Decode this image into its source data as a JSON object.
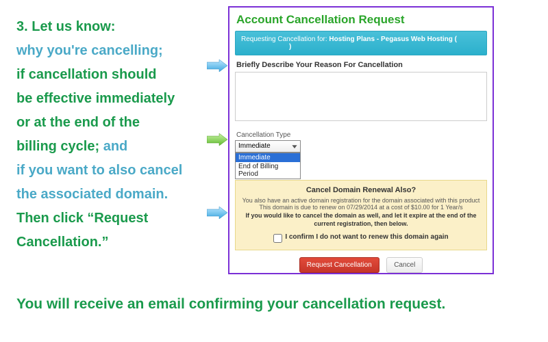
{
  "instructions": {
    "lead": "3. Let us know:",
    "line1": "why you're cancelling;",
    "line2a": "if cancellation should",
    "line2b": "be effective immediately",
    "line2c": "or at the end of the",
    "line2d": "billing cycle;",
    "and_word": " and",
    "line3a": "if you want to also cancel",
    "line3b": "the associated domain.",
    "then": "Then click “Request Cancellation.”"
  },
  "bottom_note": "You will receive an email confirming your cancellation request.",
  "panel": {
    "title": "Account Cancellation Request",
    "sub_prefix": "Requesting Cancellation for: ",
    "sub_bold": "Hosting Plans - Pegasus Web Hosting (",
    "sub_close": ")",
    "reason_label": "Briefly Describe Your Reason For Cancellation",
    "reason_value": "",
    "ct_label": "Cancellation Type",
    "ct_selected": "Immediate",
    "ct_options": {
      "0": "Immediate",
      "1": "End of Billing Period"
    },
    "domain": {
      "title": "Cancel Domain Renewal Also?",
      "p1": "You also have an active domain registration for the domain associated with this product",
      "p2": "This domain is due to renew on 07/29/2014 at a cost of $10.00 for 1 Year/s",
      "p3": "If you would like to cancel the domain as well, and let it expire at the end of the current registration, then below.",
      "confirm": "I confirm I do not want to renew this domain again"
    },
    "buttons": {
      "request": "Request Cancellation",
      "cancel": "Cancel"
    }
  }
}
